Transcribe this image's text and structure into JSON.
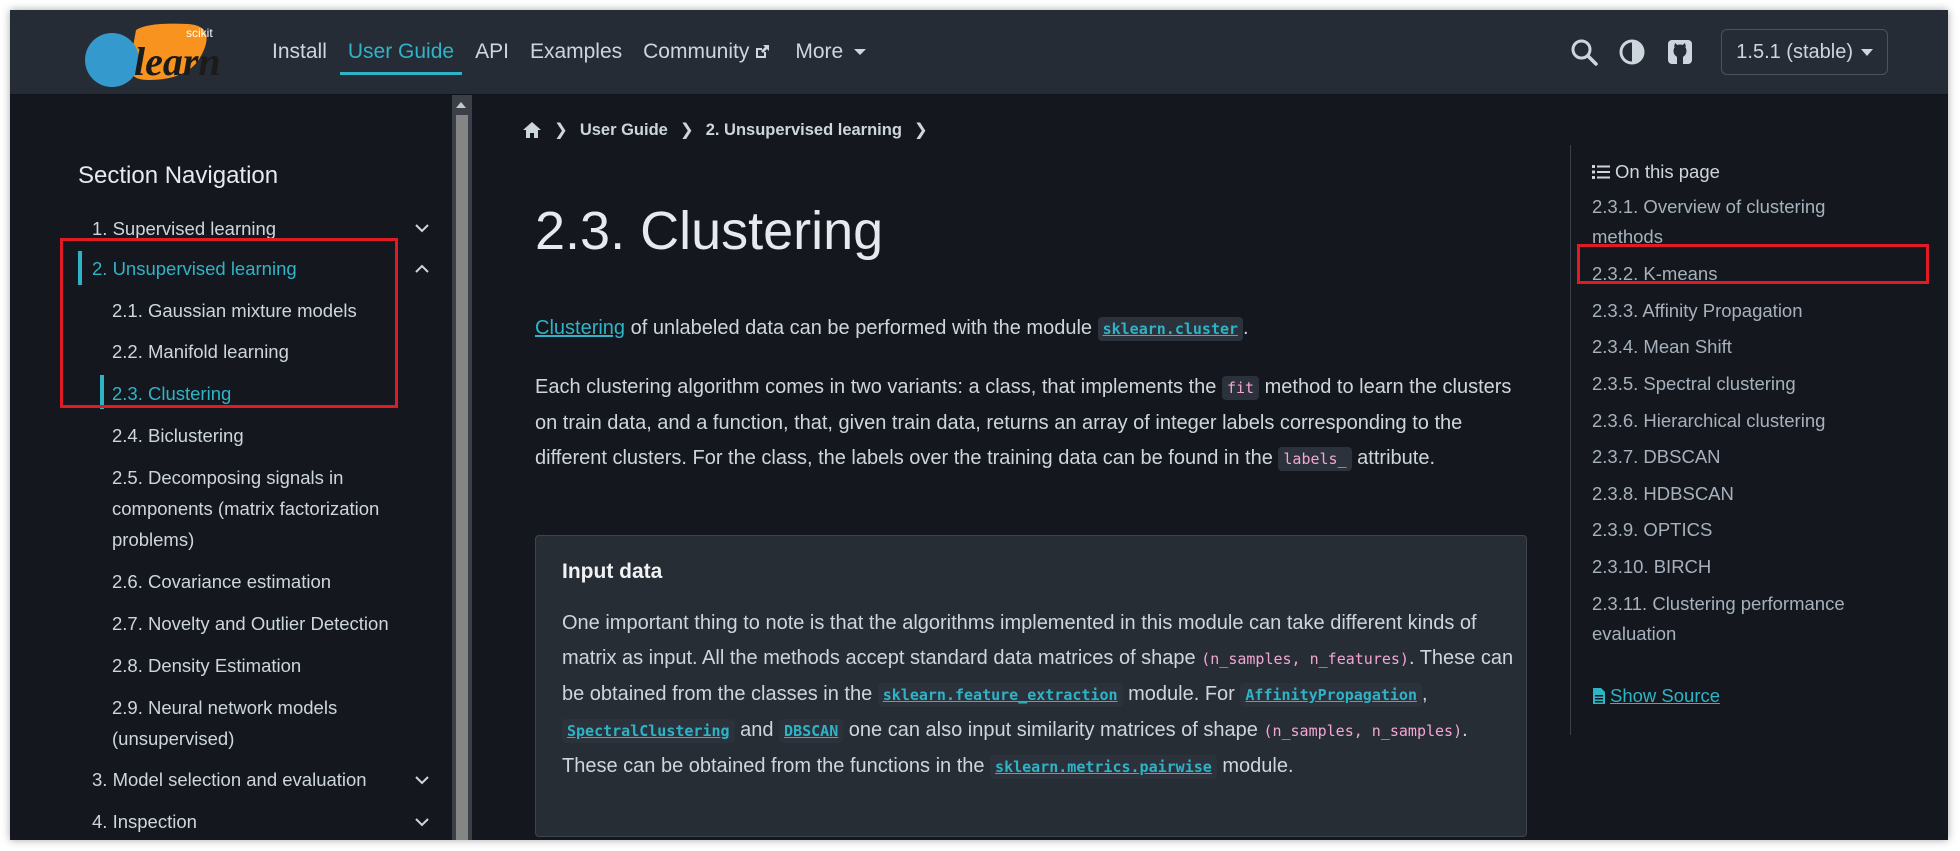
{
  "navbar": {
    "logo_text": "scikit learn",
    "links": [
      {
        "label": "Install"
      },
      {
        "label": "User Guide"
      },
      {
        "label": "API"
      },
      {
        "label": "Examples"
      },
      {
        "label": "Community"
      },
      {
        "label": "More"
      }
    ],
    "version": "1.5.1 (stable)",
    "icons": [
      "search-icon",
      "theme-toggle-icon",
      "github-icon"
    ]
  },
  "sidebar": {
    "title": "Section Navigation",
    "items": [
      {
        "label": "1. Supervised learning"
      },
      {
        "label": "2. Unsupervised learning"
      },
      {
        "label": "2.1. Gaussian mixture models"
      },
      {
        "label": "2.2. Manifold learning"
      },
      {
        "label": "2.3. Clustering"
      },
      {
        "label": "2.4. Biclustering"
      },
      {
        "label": "2.5. Decomposing signals in components (matrix factorization problems)"
      },
      {
        "label": "2.6. Covariance estimation"
      },
      {
        "label": "2.7. Novelty and Outlier Detection"
      },
      {
        "label": "2.8. Density Estimation"
      },
      {
        "label": "2.9. Neural network models (unsupervised)"
      },
      {
        "label": "3. Model selection and evaluation"
      },
      {
        "label": "4. Inspection"
      }
    ]
  },
  "breadcrumb": {
    "items": [
      "User Guide",
      "2. Unsupervised learning"
    ]
  },
  "main": {
    "title": "2.3. Clustering",
    "p1": {
      "link": "Clustering",
      "text": " of unlabeled data can be performed with the module ",
      "code": "sklearn.cluster",
      "end": "."
    },
    "p2": {
      "a": "Each clustering algorithm comes in two variants: a class, that implements the ",
      "code1": "fit",
      "b": " method to learn the clusters on train data, and a function, that, given train data, returns an array of integer labels corresponding to the different clusters. For the class, the labels over the training data can be found in the ",
      "code2": "labels_",
      "c": " attribute."
    },
    "admonition": {
      "title": "Input data",
      "a": "One important thing to note is that the algorithms implemented in this module can take different kinds of matrix as input. All the methods accept standard data matrices of shape ",
      "code1": "(n_samples, n_features)",
      "b": ". These can be obtained from the classes in the ",
      "link1": "sklearn.feature_extraction",
      "c": " module. For ",
      "link2": "AffinityPropagation",
      "comma": ", ",
      "link3": "SpectralClustering",
      "and": " and ",
      "link4": "DBSCAN",
      "d": " one can also input similarity matrices of shape ",
      "code2": "(n_samples, n_samples)",
      "e": ". These can be obtained from the functions in the ",
      "link5": "sklearn.metrics.pairwise",
      "f": " module."
    }
  },
  "toc": {
    "title": "On this page",
    "items": [
      {
        "label": "2.3.1. Overview of clustering methods"
      },
      {
        "label": "2.3.2. K-means"
      },
      {
        "label": "2.3.3. Affinity Propagation"
      },
      {
        "label": "2.3.4. Mean Shift"
      },
      {
        "label": "2.3.5. Spectral clustering"
      },
      {
        "label": "2.3.6. Hierarchical clustering"
      },
      {
        "label": "2.3.7. DBSCAN"
      },
      {
        "label": "2.3.8. HDBSCAN"
      },
      {
        "label": "2.3.9. OPTICS"
      },
      {
        "label": "2.3.10. BIRCH"
      },
      {
        "label": "2.3.11. Clustering performance evaluation"
      }
    ],
    "show_source": "Show Source"
  },
  "colors": {
    "accent": "#2fb3c6",
    "background": "#14181e",
    "navbar": "#262c35",
    "highlight": "#e01b24",
    "logo_orange": "#f7931e",
    "logo_blue": "#3499cd"
  }
}
